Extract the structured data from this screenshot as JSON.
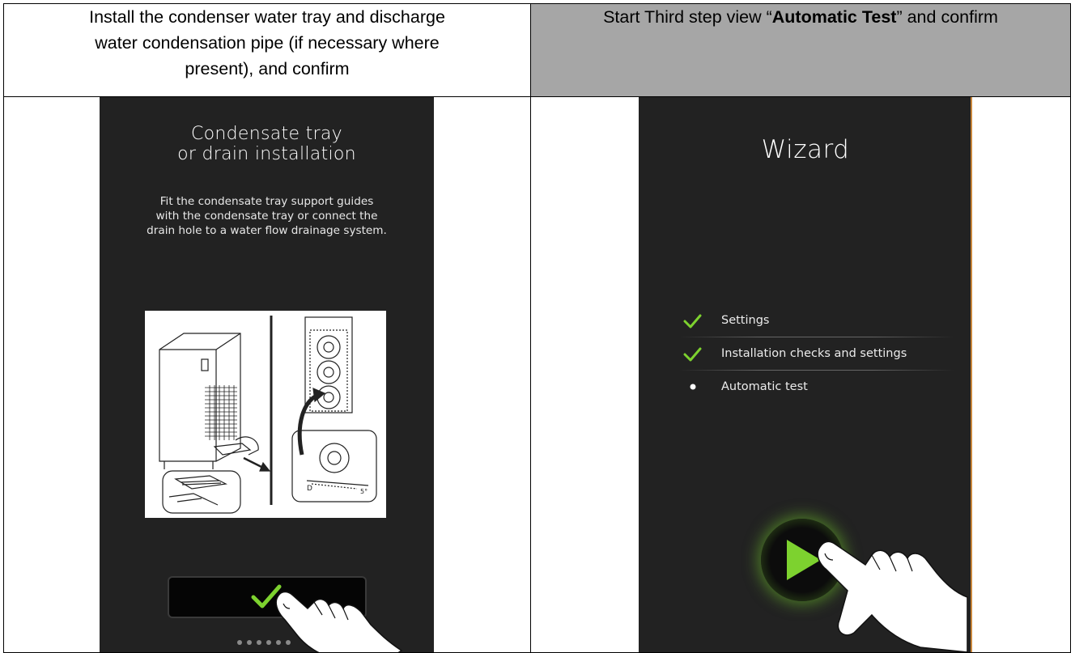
{
  "table": {
    "left_header": {
      "lines": [
        "Install the condenser water tray and discharge",
        "water condensation pipe (if necessary where",
        "present), and confirm"
      ]
    },
    "right_header": {
      "before": "Start Third step view “",
      "bold": "Automatic Test",
      "after": "” and confirm"
    }
  },
  "screen1": {
    "title_lines": [
      "Condensate tray",
      "or drain installation"
    ],
    "desc_lines": [
      "Fit the condensate tray support guides",
      "with the condensate tray or connect the",
      "drain hole to a water flow drainage system."
    ],
    "illustration_labels": {
      "d": "D",
      "angle": "5°"
    },
    "confirm_icon": "checkmark-icon",
    "page_dots": 6
  },
  "screen2": {
    "title": "Wizard",
    "steps": [
      {
        "label": "Settings",
        "status": "done",
        "icon": "checkmark-icon"
      },
      {
        "label": "Installation checks and settings",
        "status": "done",
        "icon": "checkmark-icon"
      },
      {
        "label": "Automatic test",
        "status": "current",
        "icon": "bullet-icon"
      }
    ],
    "start_icon": "play-icon"
  },
  "colors": {
    "screen_bg": "#222222",
    "accent_green": "#7dd22f",
    "header_gray": "#a6a6a6",
    "border_orange": "#c8863b"
  }
}
